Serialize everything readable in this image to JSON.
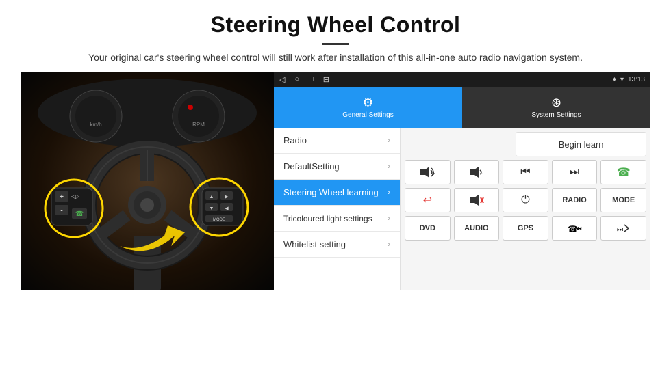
{
  "header": {
    "title": "Steering Wheel Control",
    "subtitle": "Your original car's steering wheel control will still work after installation of this all-in-one auto radio navigation system."
  },
  "statusBar": {
    "time": "13:13",
    "navIcons": [
      "◁",
      "○",
      "□",
      "⊟"
    ]
  },
  "tabs": [
    {
      "id": "general",
      "label": "General Settings",
      "active": true
    },
    {
      "id": "system",
      "label": "System Settings",
      "active": false
    }
  ],
  "menuItems": [
    {
      "id": "radio",
      "label": "Radio",
      "active": false
    },
    {
      "id": "default",
      "label": "DefaultSetting",
      "active": false
    },
    {
      "id": "steering",
      "label": "Steering Wheel learning",
      "active": true
    },
    {
      "id": "tricoloured",
      "label": "Tricoloured light settings",
      "active": false
    },
    {
      "id": "whitelist",
      "label": "Whitelist setting",
      "active": false
    }
  ],
  "buttonPanel": {
    "beginLearnLabel": "Begin learn",
    "rows": [
      [
        "vol+",
        "vol-",
        "prev-track",
        "next-track",
        "phone"
      ],
      [
        "hang-up",
        "mute",
        "power",
        "RADIO",
        "MODE"
      ],
      [
        "DVD",
        "AUDIO",
        "GPS",
        "src-prev",
        "src-next"
      ]
    ],
    "buttons": {
      "row1": [
        "▶◀+",
        "▶◀-",
        "⏮",
        "⏭",
        "☎"
      ],
      "row2": [
        "↩",
        "🔇",
        "⏻",
        "RADIO",
        "MODE"
      ],
      "row3": [
        "DVD",
        "AUDIO",
        "GPS",
        "⏮",
        "⏭"
      ]
    }
  }
}
